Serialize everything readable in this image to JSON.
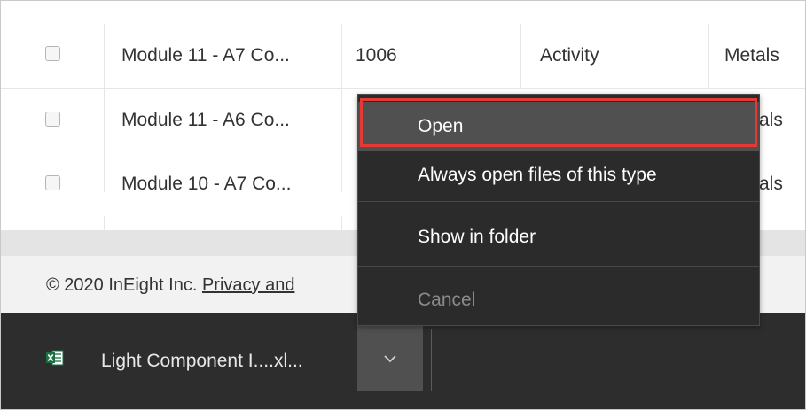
{
  "table": {
    "rows": [
      {
        "name": "Module 11 - A7 Co...",
        "id": "1006",
        "type": "Activity",
        "category": "Metals"
      },
      {
        "name": "Module 11 - A6 Co...",
        "id": "",
        "type": "",
        "category": "als"
      },
      {
        "name": "Module 10 - A7 Co...",
        "id": "",
        "type": "",
        "category": "als"
      }
    ]
  },
  "footer": {
    "copyright": "© 2020 InEight Inc. ",
    "privacy_link": "Privacy and"
  },
  "download_bar": {
    "file_name": "Light Component I....xl...",
    "file_icon": "excel-file-icon",
    "chevron_icon": "chevron-down-icon"
  },
  "context_menu": {
    "open": "Open",
    "always_open": "Always open files of this type",
    "show_in_folder": "Show in folder",
    "cancel": "Cancel"
  },
  "colors": {
    "highlight": "#e53935",
    "menu_bg": "#2b2b2b",
    "download_bar_bg": "#2d2d2d",
    "excel_green": "#1d7044"
  }
}
